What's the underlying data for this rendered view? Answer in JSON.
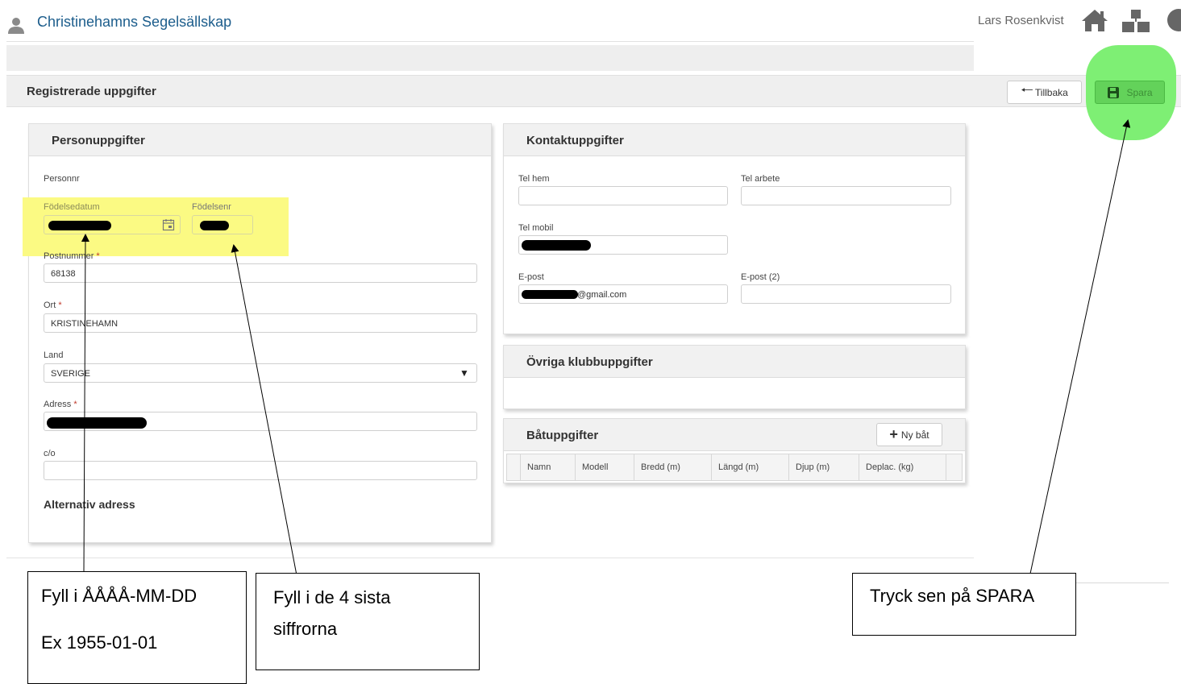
{
  "header": {
    "title": "Christinehamns Segelsällskap",
    "username": "Lars Rosenkvist"
  },
  "toolbar": {
    "page_title": "Registrerade uppgifter",
    "back_label": "Tillbaka",
    "save_label": "Spara"
  },
  "person_panel": {
    "title": "Personuppgifter",
    "personnr_label": "Personnr",
    "birthdate_label": "Födelsedatum",
    "birthnr_label": "Födelsenr",
    "postcode_label": "Postnummer",
    "postcode_value": "68138",
    "city_label": "Ort",
    "city_value": "KRISTINEHAMN",
    "country_label": "Land",
    "country_value": "SVERIGE",
    "address_label": "Adress",
    "co_label": "c/o",
    "alt_address_title": "Alternativ adress",
    "required_mark": "*"
  },
  "contact_panel": {
    "title": "Kontaktuppgifter",
    "tel_home_label": "Tel hem",
    "tel_work_label": "Tel arbete",
    "tel_mobile_label": "Tel mobil",
    "email_label": "E-post",
    "email_value_suffix": "@gmail.com",
    "email2_label": "E-post (2)"
  },
  "club_panel": {
    "title": "Övriga klubbuppgifter"
  },
  "boat_panel": {
    "title": "Båtuppgifter",
    "new_boat_label": "Ny båt",
    "columns": [
      "Namn",
      "Modell",
      "Bredd (m)",
      "Längd (m)",
      "Djup (m)",
      "Deplac. (kg)"
    ]
  },
  "callouts": {
    "date_line1": "Fyll i ÅÅÅÅ-MM-DD",
    "date_line2": "Ex 1955-01-01",
    "digits_line1": "Fyll i de 4 sista",
    "digits_line2": "siffrorna",
    "save_note": "Tryck sen på SPARA"
  },
  "colors": {
    "brand": "#1c5d8c",
    "highlight_yellow": "#fbfa83",
    "highlight_green": "#7eef74",
    "save_button": "#63d25a"
  }
}
